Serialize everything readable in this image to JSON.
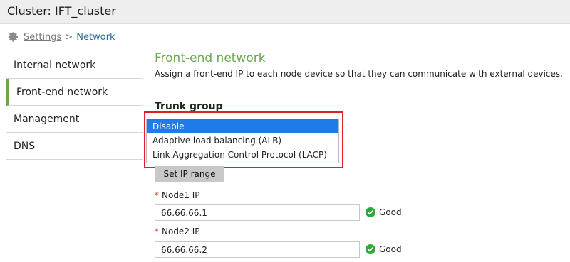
{
  "header": {
    "title": "Cluster: IFT_cluster"
  },
  "breadcrumb": {
    "parent": "Settings",
    "separator": ">",
    "current": "Network"
  },
  "sidebar": {
    "items": [
      {
        "label": "Internal network"
      },
      {
        "label": "Front-end network"
      },
      {
        "label": "Management"
      },
      {
        "label": "DNS"
      }
    ]
  },
  "main": {
    "title": "Front-end network",
    "description": "Assign a front-end IP to each node device so that they can communicate with external devices.",
    "trunk_label": "Trunk group",
    "trunk_options": [
      "Disable",
      "Adaptive load balancing (ALB)",
      "Link Aggregation Control Protocol (LACP)"
    ],
    "set_ip_range_label": "Set IP range",
    "nodes": [
      {
        "label": "Node1 IP",
        "value": "66.66.66.1",
        "status": "Good"
      },
      {
        "label": "Node2 IP",
        "value": "66.66.66.2",
        "status": "Good"
      }
    ]
  },
  "colors": {
    "accent_green": "#6aa84f",
    "highlight_red": "#e0202a",
    "selected_blue": "#1e7ce8",
    "ok_green": "#2eaa3a"
  },
  "icons": {
    "breadcrumb_icon": "gear-icon",
    "status_icon": "check-circle-icon"
  }
}
